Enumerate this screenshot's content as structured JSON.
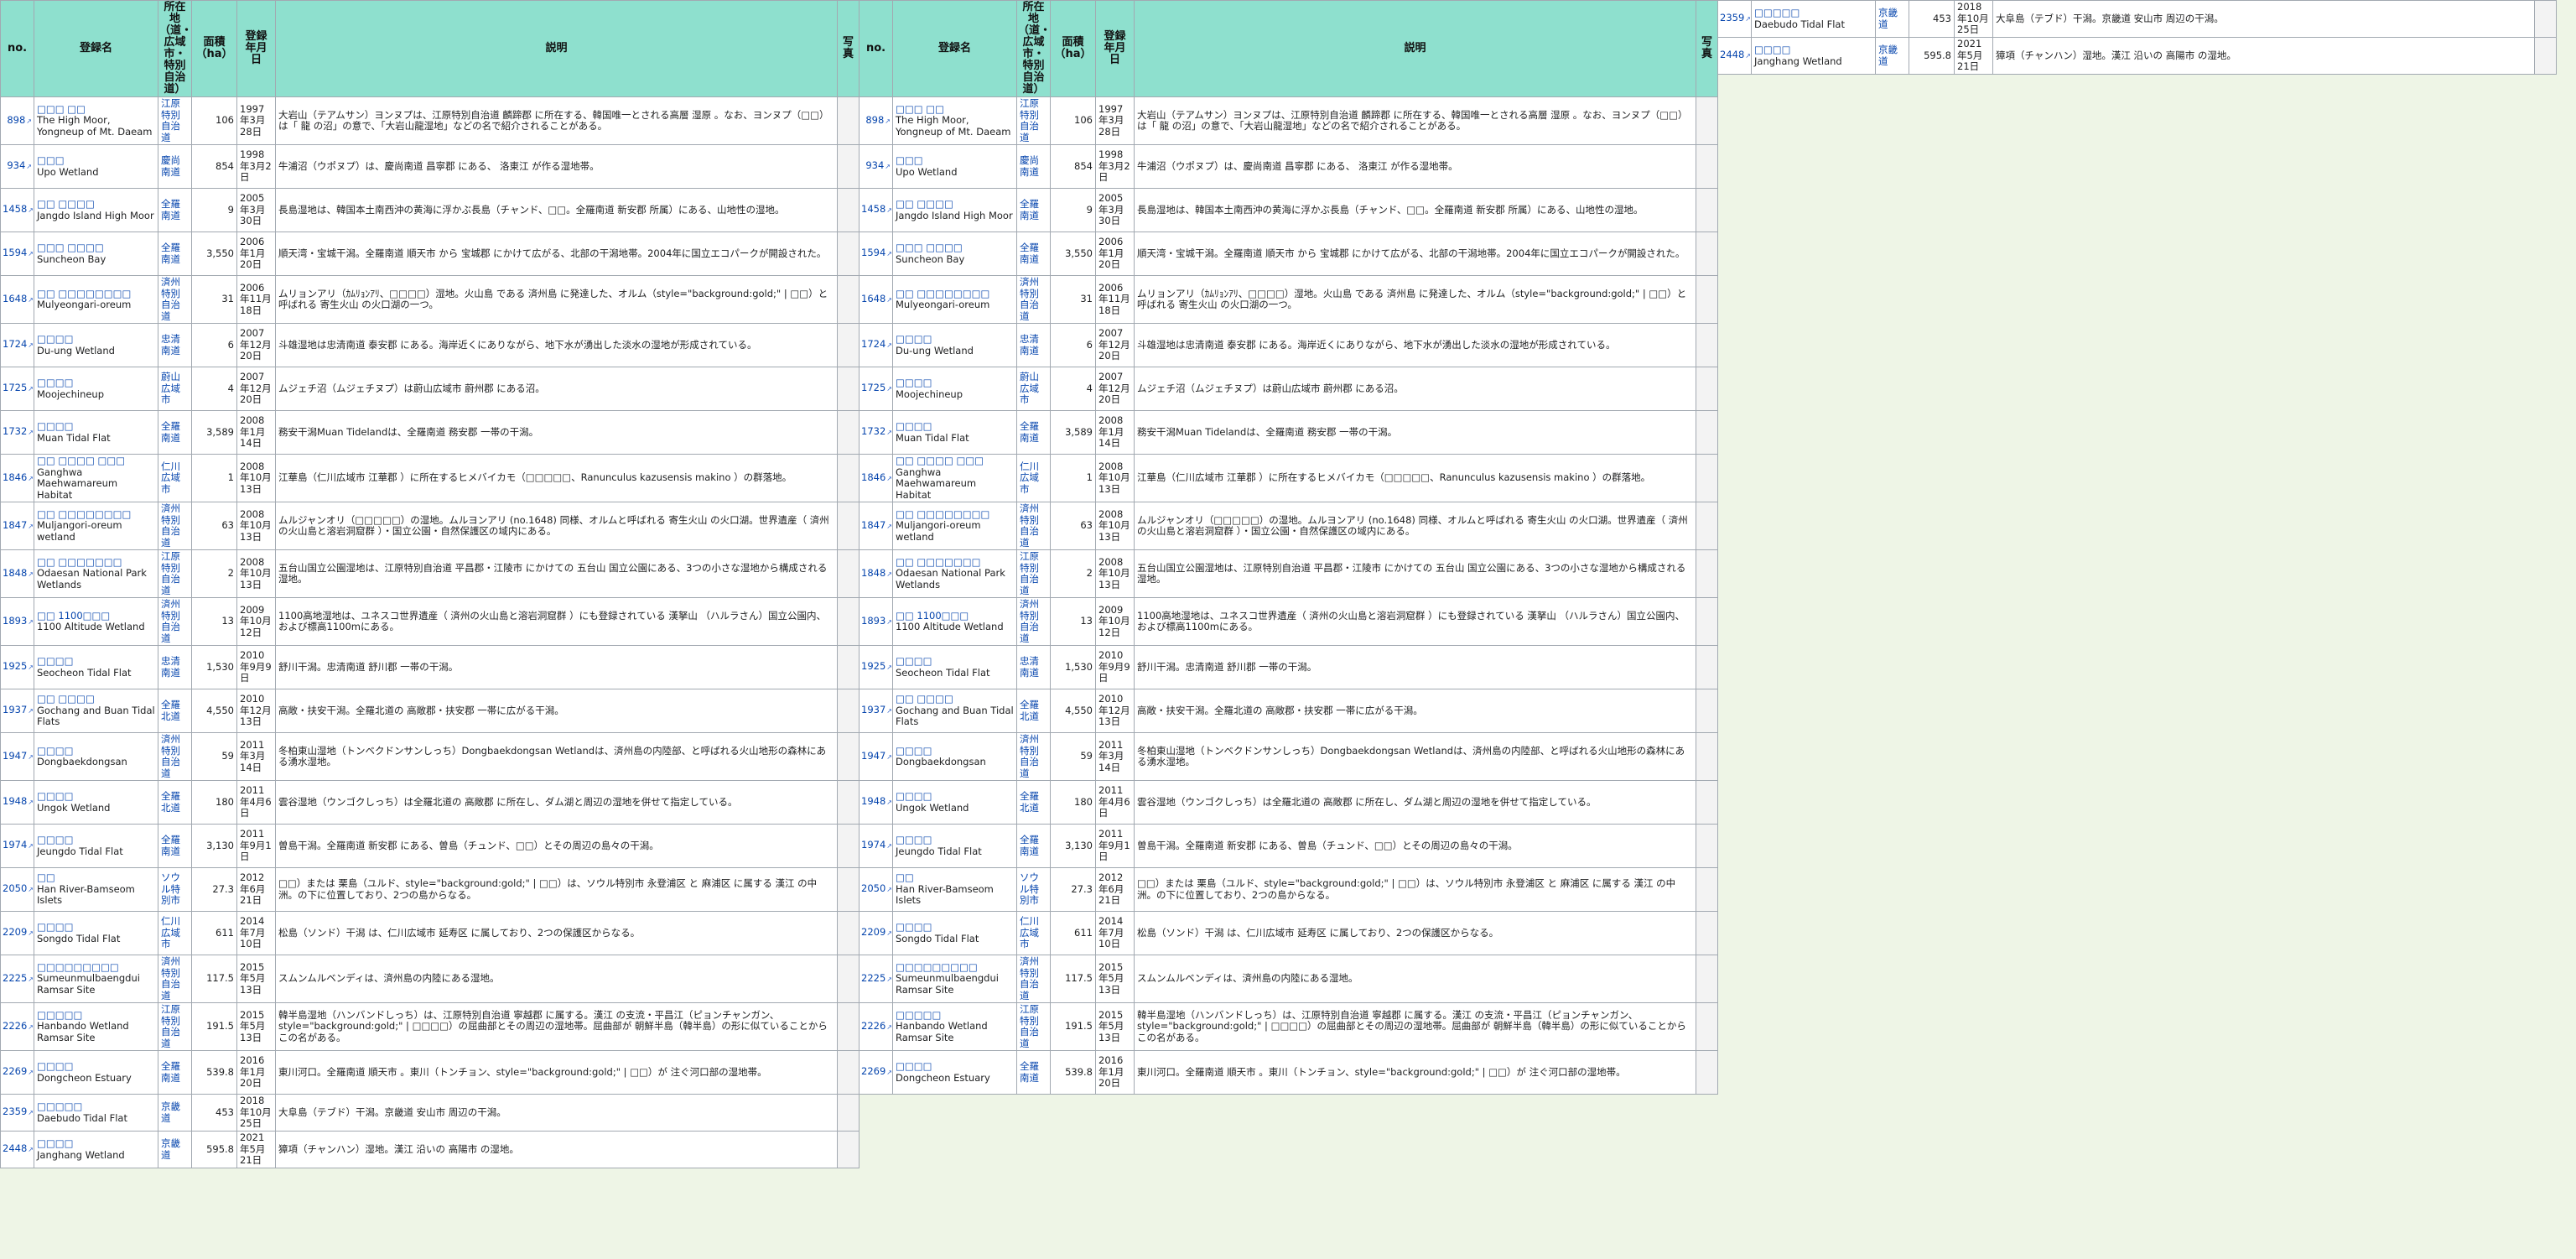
{
  "headers": {
    "no": "no.",
    "name": "登録名",
    "location": "所在地（道・広域市・特別自治道）",
    "location_lines": [
      "所在",
      "地",
      "（道・",
      "広域",
      "市・",
      "特別",
      "自治",
      "道）"
    ],
    "area": "面積（ha）",
    "area_lines": [
      "面積",
      "（ha）"
    ],
    "date": "登録年月日",
    "date_lines": [
      "登録",
      "年月",
      "日"
    ],
    "desc": "説明",
    "photo": "写真",
    "photo_lines": [
      "写",
      "真"
    ]
  },
  "rows": [
    {
      "no": "898",
      "ko": "□□□ □□",
      "name": "The High Moor, Yongneup of Mt. Daeam",
      "pref": "江原特別自治道",
      "area": "106",
      "date": "1997年3月28日",
      "desc": "大岩山（テアムサン）ヨンヌプは、江原特別自治道 麟蹄郡 に所在する、韓国唯一とされる高層 湿原 。なお、ヨンヌプ（□□）は「 龍 の沼」の意で、「大岩山龍湿地」などの名で紹介されることがある。"
    },
    {
      "no": "934",
      "ko": "□□□",
      "name": "Upo Wetland",
      "pref": "慶尚南道",
      "area": "854",
      "date": "1998年3月2日",
      "desc": "牛浦沼（ウポヌプ）は、慶尚南道 昌寧郡 にある、 洛東江 が作る湿地帯。"
    },
    {
      "no": "1458",
      "ko": "□□ □□□□",
      "name": "Jangdo Island High Moor",
      "pref": "全羅南道",
      "area": "9",
      "date": "2005年3月30日",
      "desc": "長島湿地は、韓国本土南西沖の黄海に浮かぶ長島（チャンド、□□。全羅南道 新安郡 所属）にある、山地性の湿地。"
    },
    {
      "no": "1594",
      "ko": "□□□ □□□□",
      "name": "Suncheon Bay",
      "pref": "全羅南道",
      "area": "3,550",
      "date": "2006年1月20日",
      "desc": "順天湾・宝城干潟。全羅南道 順天市 から 宝城郡 にかけて広がる、北部の干潟地帯。2004年に国立エコパークが開設された。"
    },
    {
      "no": "1648",
      "ko": "□□ □□□□□□□□",
      "name": "Mulyeongari-oreum",
      "pref": "済州特別自治道",
      "area": "31",
      "date": "2006年11月18日",
      "desc": "ムリョンアリ（ｶﾑﾘｮﾝｱﾘ、□□□□）湿地。火山島 である 済州島 に発達した、オルム（style=\"background:gold;\" | □□）と呼ばれる 寄生火山 の火口湖の一つ。"
    },
    {
      "no": "1724",
      "ko": "□□□□",
      "name": "Du-ung Wetland",
      "pref": "忠清南道",
      "area": "6",
      "date": "2007年12月20日",
      "desc": "斗雄湿地は忠清南道 泰安郡 にある。海岸近くにありながら、地下水が湧出した淡水の湿地が形成されている。"
    },
    {
      "no": "1725",
      "ko": "□□□□",
      "name": "Moojechineup",
      "pref": "蔚山広域市",
      "area": "4",
      "date": "2007年12月20日",
      "desc": "ムジェチ沼（ムジェチヌプ）は蔚山広域市 蔚州郡 にある沼。"
    },
    {
      "no": "1732",
      "ko": "□□□□",
      "name": "Muan Tidal Flat",
      "pref": "全羅南道",
      "area": "3,589",
      "date": "2008年1月14日",
      "desc": "務安干潟Muan Tidelandは、全羅南道 務安郡 一帯の干潟。"
    },
    {
      "no": "1846",
      "ko": "□□ □□□□ □□□",
      "name": "Ganghwa Maehwamareum Habitat",
      "pref": "仁川広域市",
      "area": "1",
      "date": "2008年10月13日",
      "desc": "江華島（仁川広域市 江華郡 ）に所在するヒメバイカモ（□□□□□、Ranunculus kazusensis makino ）の群落地。"
    },
    {
      "no": "1847",
      "ko": "□□ □□□□□□□□",
      "name": "Muljangori-oreum wetland",
      "pref": "済州特別自治道",
      "area": "63",
      "date": "2008年10月13日",
      "desc": "ムルジャンオリ（□□□□□）の湿地。ムルヨンアリ (no.1648) 同様、オルムと呼ばれる 寄生火山 の火口湖。世界遺産（ 済州の火山島と溶岩洞窟群 ）・国立公園・自然保護区の域内にある。"
    },
    {
      "no": "1848",
      "ko": "□□ □□□□□□□",
      "name": "Odaesan National Park Wetlands",
      "pref": "江原特別自治道",
      "area": "2",
      "date": "2008年10月13日",
      "desc": "五台山国立公園湿地は、江原特別自治道 平昌郡・江陵市 にかけての 五台山 国立公園にある、3つの小さな湿地から構成される湿地。"
    },
    {
      "no": "1893",
      "ko": "□□ 1100□□□",
      "name": "1100 Altitude Wetland",
      "pref": "済州特別自治道",
      "area": "13",
      "date": "2009年10月12日",
      "desc": "1100高地湿地は、ユネスコ世界遺産（ 済州の火山島と溶岩洞窟群 ）にも登録されている 漢拏山 （ハルラさん）国立公園内、および標高1100mにある。"
    },
    {
      "no": "1925",
      "ko": "□□□□",
      "name": "Seocheon Tidal Flat",
      "pref": "忠清南道",
      "area": "1,530",
      "date": "2010年9月9日",
      "desc": "舒川干潟。忠清南道 舒川郡 一帯の干潟。"
    },
    {
      "no": "1937",
      "ko": "□□ □□□□",
      "name": "Gochang and Buan Tidal Flats",
      "pref": "全羅北道",
      "area": "4,550",
      "date": "2010年12月13日",
      "desc": "高敞・扶安干潟。全羅北道の 高敞郡・扶安郡 一帯に広がる干潟。"
    },
    {
      "no": "1947",
      "ko": "□□□□",
      "name": "Dongbaekdongsan",
      "pref": "済州特別自治道",
      "area": "59",
      "date": "2011年3月14日",
      "desc": "冬柏東山湿地（トンベクドンサンしっち）Dongbaekdongsan Wetlandは、済州島の内陸部、と呼ばれる火山地形の森林にある湧水湿地。"
    },
    {
      "no": "1948",
      "ko": "□□□□",
      "name": "Ungok Wetland",
      "pref": "全羅北道",
      "area": "180",
      "date": "2011年4月6日",
      "desc": "雲谷湿地（ウンゴクしっち）は全羅北道の 高敞郡 に所在し、ダム湖と周辺の湿地を併せて指定している。"
    },
    {
      "no": "1974",
      "ko": "□□□□",
      "name": "Jeungdo Tidal Flat",
      "pref": "全羅南道",
      "area": "3,130",
      "date": "2011年9月1日",
      "desc": "曽島干潟。全羅南道 新安郡 にある、曽島（チュンド、□□）とその周辺の島々の干潟。"
    },
    {
      "no": "2050",
      "ko": "□□",
      "name": "Han River-Bamseom Islets",
      "pref": "ソウル特別市",
      "area": "27.3",
      "date": "2012年6月21日",
      "desc": "□□）または 栗島（ユルド、style=\"background:gold;\" | □□）は、ソウル特別市 永登浦区 と 麻浦区 に属する 漢江 の中洲。の下に位置しており、2つの島からなる。"
    },
    {
      "no": "2209",
      "ko": "□□□□",
      "name": "Songdo Tidal Flat",
      "pref": "仁川広域市",
      "area": "611",
      "date": "2014年7月10日",
      "desc": "松島（ソンド）干潟 は、仁川広域市 延寿区 に属しており、2つの保護区からなる。"
    },
    {
      "no": "2225",
      "ko": "□□□□□□□□□",
      "name": "Sumeunmulbaengdui Ramsar Site",
      "pref": "済州特別自治道",
      "area": "117.5",
      "date": "2015年5月13日",
      "desc": "スムンムルベンディは、済州島の内陸にある湿地。"
    },
    {
      "no": "2226",
      "ko": "□□□□□",
      "name": "Hanbando Wetland Ramsar Site",
      "pref": "江原特別自治道",
      "area": "191.5",
      "date": "2015年5月13日",
      "desc": "韓半島湿地（ハンバンドしっち）は、江原特別自治道 寧越郡 に属する。漢江 の支流・平昌江（ピョンチャンガン、style=\"background:gold;\" | □□□□）の屈曲部とその周辺の湿地帯。屈曲部が 朝鮮半島（韓半島）の形に似ていることからこの名がある。"
    },
    {
      "no": "2269",
      "ko": "□□□□",
      "name": "Dongcheon Estuary",
      "pref": "全羅南道",
      "area": "539.8",
      "date": "2016年1月20日",
      "desc": "東川河口。全羅南道 順天市 。東川（トンチョン、style=\"background:gold;\" | □□）が 注ぐ河口部の湿地帯。"
    },
    {
      "no": "2359",
      "ko": "□□□□□",
      "name": "Daebudo Tidal Flat",
      "pref": "京畿道",
      "area": "453",
      "date": "2018年10月25日",
      "desc": "大阜島（テブド）干潟。京畿道 安山市 周辺の干潟。"
    },
    {
      "no": "2448",
      "ko": "□□□□",
      "name": "Janghang Wetland",
      "pref": "京畿道",
      "area": "595.8",
      "date": "2021年5月21日",
      "desc": "獐項（チャンハン）湿地。漢江 沿いの 高陽市 の湿地。"
    }
  ],
  "colors": {
    "header_bg": "#8ee0ce",
    "link": "#0645ad",
    "border": "#a2a9b1",
    "page_bg": "#eef5e6"
  }
}
